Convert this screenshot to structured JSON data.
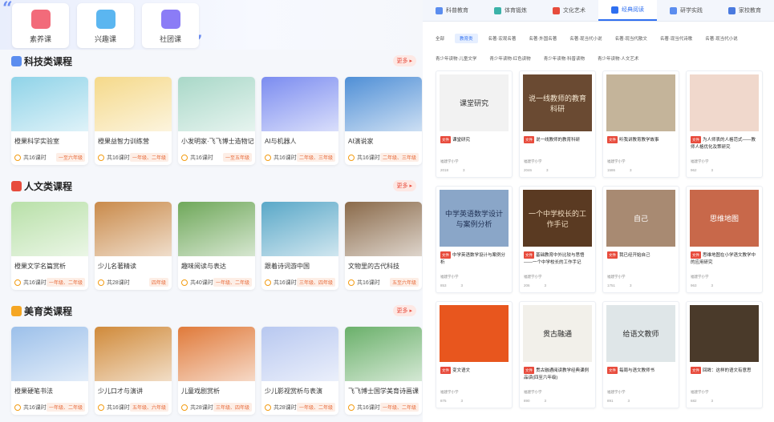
{
  "left": {
    "categories": [
      {
        "label": "素养课",
        "color": "#f26b7a"
      },
      {
        "label": "兴趣课",
        "color": "#5bb6f0"
      },
      {
        "label": "社团课",
        "color": "#8b7cf6"
      }
    ],
    "sections": [
      {
        "title": "科技类课程",
        "more": "更多 ▸",
        "icon_color": "#5b8def",
        "courses": [
          {
            "title": "橙果科学实验室",
            "lessons": "共16课时",
            "grade": "一至六年级",
            "thumb": "#8fd3e8"
          },
          {
            "title": "橙果益智力训练营",
            "lessons": "共16课时",
            "grade": "一年级、二年级",
            "thumb": "#f5d98a"
          },
          {
            "title": "小发明家·飞飞博士造物记",
            "lessons": "共16课时",
            "grade": "一至五年级",
            "thumb": "#a9d8c8"
          },
          {
            "title": "AI与机器人",
            "lessons": "共16课时",
            "grade": "二年级、三年级",
            "thumb": "#7b8cf0"
          },
          {
            "title": "AI演说家",
            "lessons": "共16课时",
            "grade": "二年级、三年级",
            "thumb": "#4f8fd6"
          }
        ]
      },
      {
        "title": "人文类课程",
        "more": "更多 ▸",
        "icon_color": "#e74c3c",
        "courses": [
          {
            "title": "橙果文学名篇赏析",
            "lessons": "共16课时",
            "grade": "一年级、二年级",
            "thumb": "#b8e0a8"
          },
          {
            "title": "少儿名著精读",
            "lessons": "共28课时",
            "grade": "四年级",
            "thumb": "#c98a4a"
          },
          {
            "title": "趣味阅读与表达",
            "lessons": "共40课时",
            "grade": "一年级、二年级",
            "thumb": "#6fa85a"
          },
          {
            "title": "跟着诗词游中国",
            "lessons": "共16课时",
            "grade": "三年级、四年级",
            "thumb": "#5aa8c8"
          },
          {
            "title": "文物里的古代科技",
            "lessons": "共16课时",
            "grade": "五至六年级",
            "thumb": "#8a6a4a"
          }
        ]
      },
      {
        "title": "美育类课程",
        "more": "更多 ▸",
        "icon_color": "#f5a623",
        "courses": [
          {
            "title": "橙果硬笔书法",
            "lessons": "共16课时",
            "grade": "一年级、二年级",
            "thumb": "#9cc0ea"
          },
          {
            "title": "少儿口才与演讲",
            "lessons": "共16课时",
            "grade": "五年级、六年级",
            "thumb": "#d08a3a"
          },
          {
            "title": "儿童戏剧赏析",
            "lessons": "共28课时",
            "grade": "三年级、四年级",
            "thumb": "#e07a3a"
          },
          {
            "title": "少儿影视赏析与表演",
            "lessons": "共28课时",
            "grade": "一年级、二年级",
            "thumb": "#b8c8f0"
          },
          {
            "title": "飞飞博士国学美育诗画课",
            "lessons": "共16课时",
            "grade": "一年级、二年级",
            "thumb": "#6ab06a"
          }
        ]
      }
    ]
  },
  "right": {
    "tabs": [
      {
        "label": "科普教育",
        "color": "#5b8def"
      },
      {
        "label": "体育锻炼",
        "color": "#3bb2a8"
      },
      {
        "label": "文化艺术",
        "color": "#e74c3c"
      },
      {
        "label": "经典阅读",
        "color": "#2f6ff0"
      },
      {
        "label": "研学实践",
        "color": "#5b8def"
      },
      {
        "label": "家校教育",
        "color": "#4a7adf"
      }
    ],
    "active_tab": 3,
    "filters": [
      "全部",
      "教育类",
      "名著·宏观名著",
      "名著·外国名著",
      "名著·现当代小说",
      "名著·现当代散文",
      "名著·现当代诗歌",
      "名著·现当代小说",
      "青少年读物·儿童文学",
      "青少年读物·红色读物",
      "青少年读物·科普读物",
      "青少年读物·人文艺术"
    ],
    "active_filter": 1,
    "books": [
      {
        "title": "课堂研究",
        "cover_text": "课堂研究",
        "cover": "#f2f2f2",
        "ink": "#333",
        "publisher": "福建学小学",
        "views": "2018",
        "likes": "3"
      },
      {
        "title": "说一线教师的教育科研",
        "cover_text": "说一线教师的教育科研",
        "cover": "#6a4a32",
        "ink": "#f3e6d0",
        "publisher": "福建学小学",
        "views": "2046",
        "likes": "3"
      },
      {
        "title": "听我讲教育教学故事",
        "cover_text": "",
        "cover": "#c4b49a",
        "ink": "#fff",
        "publisher": "福建学小学",
        "views": "1586",
        "likes": "3"
      },
      {
        "title": "为人师表的人格范式——教师人格优化及策研究",
        "cover_text": "",
        "cover": "#f0d8cc",
        "ink": "#c07070",
        "publisher": "福建学小学",
        "views": "962",
        "likes": "3"
      },
      {
        "title": "中学英语数学设计与案例分析",
        "cover_text": "中学英语数学设计与案例分析",
        "cover": "#8aa6c8",
        "ink": "#1e2f52",
        "publisher": "福建学小学",
        "views": "853",
        "likes": "3"
      },
      {
        "title": "基础教育中外比较与思悟——一个中学校长的工作手记",
        "cover_text": "一个中学校长的工作手记",
        "cover": "#5a3a22",
        "ink": "#f0dcc0",
        "publisher": "福建学小学",
        "views": "206",
        "likes": "3"
      },
      {
        "title": "我已经开始自己",
        "cover_text": "自己",
        "cover": "#a88a72",
        "ink": "#fff",
        "publisher": "福建学小学",
        "views": "1751",
        "likes": "3"
      },
      {
        "title": "思维地图在小学语文教学中的应用研究",
        "cover_text": "思维地图",
        "cover": "#c8684a",
        "ink": "#fff",
        "publisher": "福建学小学",
        "views": "963",
        "likes": "3"
      },
      {
        "title": "变文语文",
        "cover_text": "",
        "cover": "#e8561e",
        "ink": "#fff",
        "publisher": "福建学小学",
        "views": "875",
        "likes": "3"
      },
      {
        "title": "贯古融通阅读教学经典课例品读(四至六年级)",
        "cover_text": "贯古融通",
        "cover": "#f2f0ea",
        "ink": "#222",
        "publisher": "福建学小学",
        "views": "890",
        "likes": "3"
      },
      {
        "title": "每周与语文教师书",
        "cover_text": "给语文教师",
        "cover": "#dfe6e8",
        "ink": "#333",
        "publisher": "福建学小学",
        "views": "891",
        "likes": "3"
      },
      {
        "title": "回眸：这样的语文有意思",
        "cover_text": "",
        "cover": "#4a3a2a",
        "ink": "#fff",
        "publisher": "福建学小学",
        "views": "682",
        "likes": "3"
      }
    ],
    "tag": "文件"
  }
}
